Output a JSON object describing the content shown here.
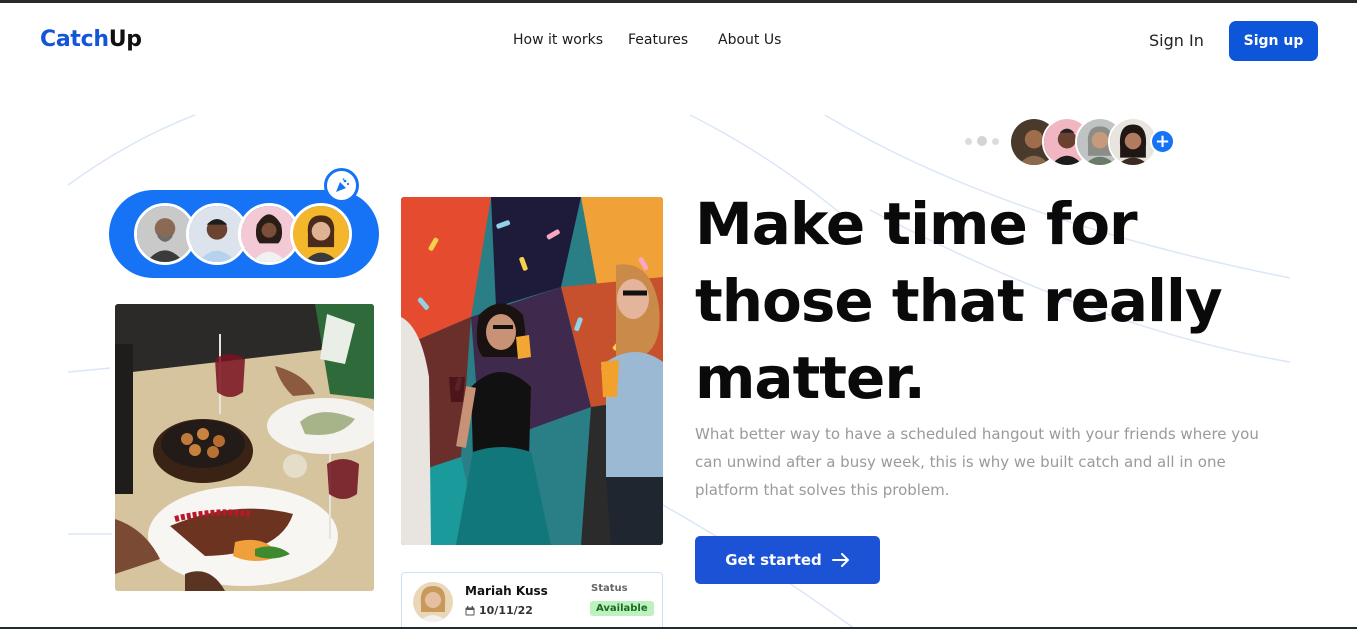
{
  "header": {
    "logo_part1": "Catch",
    "logo_part2": "Up",
    "nav": [
      "How it works",
      "Features",
      "About Us"
    ],
    "signin_label": "Sign In",
    "signup_label": "Sign up"
  },
  "hero": {
    "headline_lines": [
      "Make time for",
      "those that really",
      "matter."
    ],
    "subtext": "What better way to have a scheduled hangout with your friends where you can unwind after a busy week, this is why we built catch and all in one platform that solves this problem.",
    "cta_label": "Get started"
  },
  "status_card": {
    "name": "Mariah Kuss",
    "date": "10/11/22",
    "status_label": "Status",
    "status_value": "Available"
  },
  "icons": {
    "badge": "party-popper-icon",
    "plus": "plus-icon",
    "calendar": "calendar-icon",
    "arrow": "arrow-right-icon"
  },
  "colors": {
    "brand_blue": "#1454d6",
    "pill_blue": "#1673f5",
    "cta_blue": "#1c52d6",
    "status_green_bg": "#bdf2c0",
    "subtext_gray": "#9a9a9a"
  }
}
